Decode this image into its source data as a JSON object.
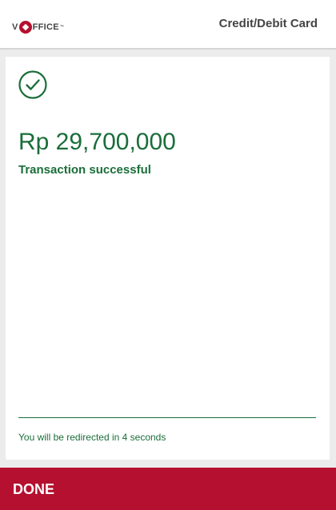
{
  "header": {
    "logo": {
      "left": "V",
      "right": "FFICE",
      "tm": "™"
    },
    "title": "Credit/Debit Card"
  },
  "result": {
    "icon": "check-circle-icon",
    "amount": "Rp 29,700,000",
    "status": "Transaction successful",
    "redirect_text": "You will be redirected in 4 seconds"
  },
  "footer": {
    "done_label": "DONE"
  },
  "colors": {
    "brand": "#b5102f",
    "success": "#1a6e3a",
    "header_text": "#444444"
  }
}
